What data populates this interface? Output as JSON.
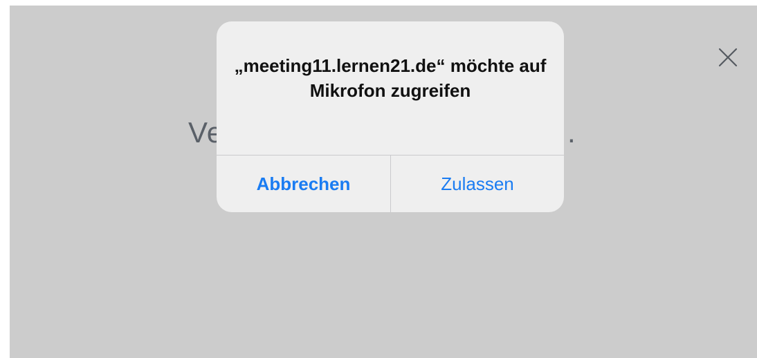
{
  "background": {
    "text_left": "Ve",
    "text_right": "."
  },
  "alert": {
    "title": "„meeting11.lernen21.de“ möchte auf Mikrofon zugreifen",
    "cancel_label": "Abbrechen",
    "allow_label": "Zulassen"
  },
  "icons": {
    "close": "close-icon"
  },
  "colors": {
    "backdrop": "#cccccc",
    "alert_bg": "#efefef",
    "accent": "#1a7cf2"
  }
}
